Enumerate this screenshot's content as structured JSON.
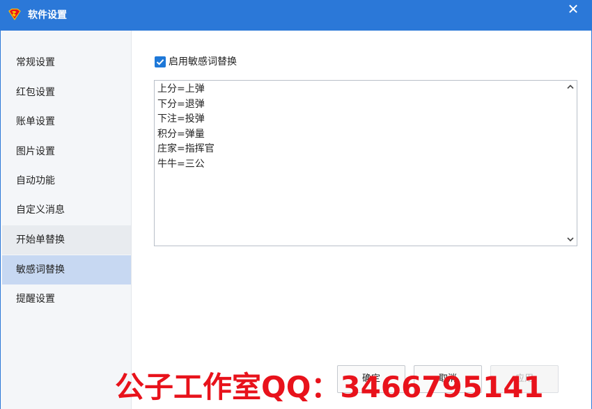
{
  "window": {
    "title": "软件设置",
    "close_glyph": "✕",
    "accent": "#2b78d8",
    "app_icon": "superman-logo-icon"
  },
  "sidebar": {
    "items": [
      {
        "label": "常规设置"
      },
      {
        "label": "红包设置"
      },
      {
        "label": "账单设置"
      },
      {
        "label": "图片设置"
      },
      {
        "label": "自动功能"
      },
      {
        "label": "自定义消息"
      },
      {
        "label": "开始单替换"
      },
      {
        "label": "敏感词替换",
        "active": true
      },
      {
        "label": "提醒设置"
      }
    ]
  },
  "panel": {
    "checkbox_label": "启用敏感词替换",
    "checkbox_checked": true,
    "rules": [
      "上分=上弹",
      "下分=退弹",
      "下注=投弹",
      "积分=弹量",
      "庄家=指挥官",
      "牛牛=三公"
    ]
  },
  "buttons": {
    "ok": "确定",
    "cancel": "取消",
    "apply": "应用"
  },
  "watermark": "公子工作室QQ：3466795141"
}
